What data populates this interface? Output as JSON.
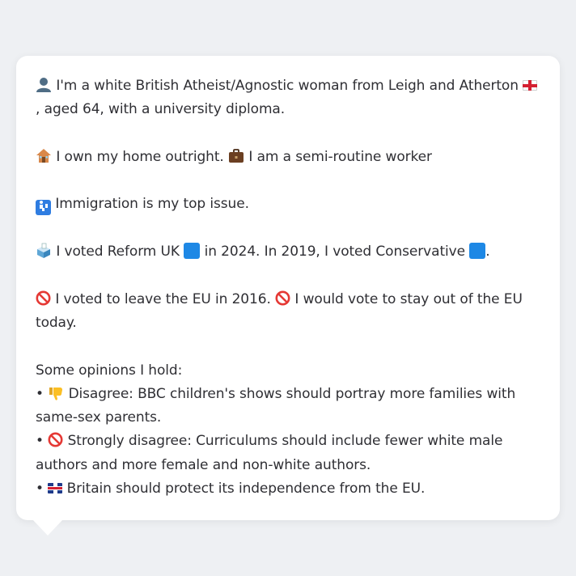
{
  "colors": {
    "background": "#eef0f3",
    "bubble": "#ffffff",
    "text": "#2f2f34",
    "party_square": "#1e88e5",
    "no_entry": "#e53935"
  },
  "profile": {
    "line1": "I'm a white British Atheist/Agnostic woman from Leigh and Atherton",
    "line1_end": ",",
    "line1_cont": "aged 64, with a university diploma.",
    "home": "I own my home outright.",
    "work": "I am a semi-routine worker",
    "issue": "Immigration is my top issue.",
    "vote_a": "I voted Reform UK",
    "vote_b": "in 2024. In 2019, I voted Conservative",
    "vote_end": ".",
    "eu_a": "I voted to leave the EU in 2016.",
    "eu_b": "I would vote to stay out of the EU today.",
    "opinions_title": "Some opinions I hold:",
    "opinions": [
      "Disagree: BBC children's shows should portray more families with same-sex parents.",
      "Strongly disagree: Curriculums should include fewer white male authors and more female and non-white authors.",
      "Britain should protect its independence from the EU."
    ],
    "bullet": "•"
  },
  "icons": {
    "person": "person-silhouette-icon",
    "england_flag": "england-flag-icon",
    "house": "house-icon",
    "briefcase": "briefcase-icon",
    "passport": "passport-control-icon",
    "ballot": "ballot-box-icon",
    "party_square": "blue-square-icon",
    "no_entry": "no-entry-icon",
    "thumbs_down": "thumbs-down-icon",
    "uk_flag": "uk-flag-icon"
  }
}
